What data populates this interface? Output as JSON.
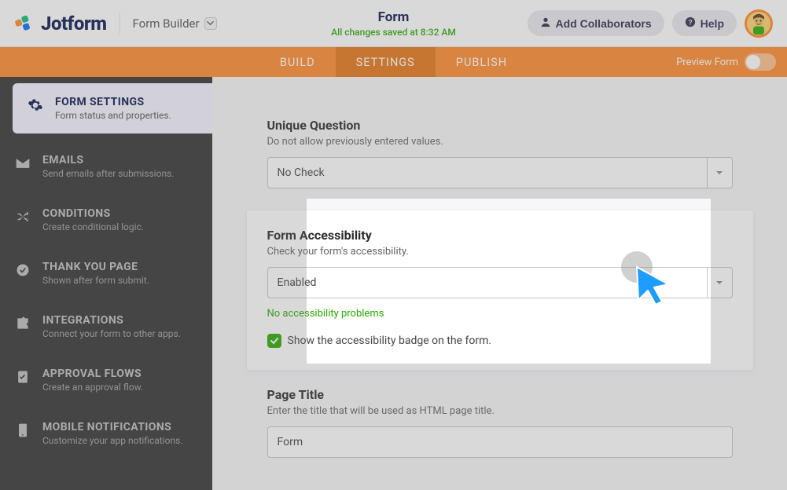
{
  "header": {
    "brand": "Jotform",
    "builder_label": "Form Builder",
    "title": "Form",
    "saved_text": "All changes saved at 8:32 AM",
    "add_collaborators": "Add Collaborators",
    "help": "Help"
  },
  "tabs": {
    "build": "BUILD",
    "settings": "SETTINGS",
    "publish": "PUBLISH",
    "preview_label": "Preview Form"
  },
  "sidebar": [
    {
      "label": "FORM SETTINGS",
      "desc": "Form status and properties.",
      "icon": "gear",
      "active": true
    },
    {
      "label": "EMAILS",
      "desc": "Send emails after submissions.",
      "icon": "mail"
    },
    {
      "label": "CONDITIONS",
      "desc": "Create conditional logic.",
      "icon": "shuffle"
    },
    {
      "label": "THANK YOU PAGE",
      "desc": "Shown after form submit.",
      "icon": "check"
    },
    {
      "label": "INTEGRATIONS",
      "desc": "Connect your form to other apps.",
      "icon": "puzzle"
    },
    {
      "label": "APPROVAL FLOWS",
      "desc": "Create an approval flow.",
      "icon": "clipboard"
    },
    {
      "label": "MOBILE NOTIFICATIONS",
      "desc": "Customize your app notifications.",
      "icon": "phone"
    }
  ],
  "sections": {
    "unique": {
      "title": "Unique Question",
      "desc": "Do not allow previously entered values.",
      "value": "No Check"
    },
    "accessibility": {
      "title": "Form Accessibility",
      "desc": "Check your form's accessibility.",
      "value": "Enabled",
      "status": "No accessibility problems",
      "checkbox_label": "Show the accessibility badge on the form."
    },
    "pagetitle": {
      "title": "Page Title",
      "desc": "Enter the title that will be used as HTML page title.",
      "value": "Form"
    }
  },
  "colors": {
    "accent_orange": "#ff8a2b",
    "accent_green": "#2aa900"
  }
}
